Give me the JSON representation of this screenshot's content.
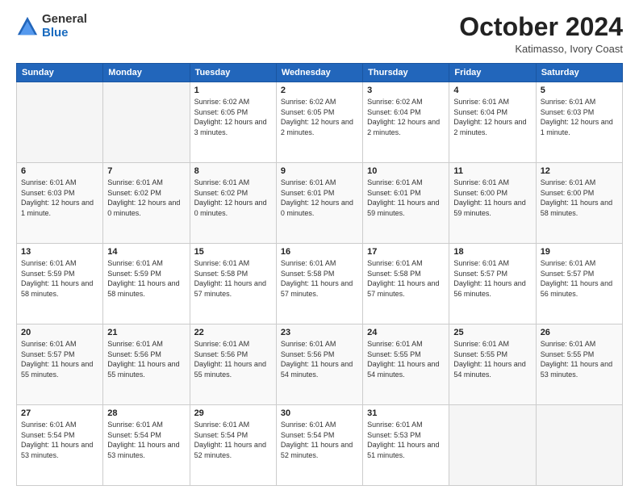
{
  "header": {
    "logo_general": "General",
    "logo_blue": "Blue",
    "month_title": "October 2024",
    "subtitle": "Katimasso, Ivory Coast"
  },
  "days_of_week": [
    "Sunday",
    "Monday",
    "Tuesday",
    "Wednesday",
    "Thursday",
    "Friday",
    "Saturday"
  ],
  "weeks": [
    [
      {
        "day": "",
        "info": ""
      },
      {
        "day": "",
        "info": ""
      },
      {
        "day": "1",
        "info": "Sunrise: 6:02 AM\nSunset: 6:05 PM\nDaylight: 12 hours\nand 3 minutes."
      },
      {
        "day": "2",
        "info": "Sunrise: 6:02 AM\nSunset: 6:05 PM\nDaylight: 12 hours\nand 2 minutes."
      },
      {
        "day": "3",
        "info": "Sunrise: 6:02 AM\nSunset: 6:04 PM\nDaylight: 12 hours\nand 2 minutes."
      },
      {
        "day": "4",
        "info": "Sunrise: 6:01 AM\nSunset: 6:04 PM\nDaylight: 12 hours\nand 2 minutes."
      },
      {
        "day": "5",
        "info": "Sunrise: 6:01 AM\nSunset: 6:03 PM\nDaylight: 12 hours\nand 1 minute."
      }
    ],
    [
      {
        "day": "6",
        "info": "Sunrise: 6:01 AM\nSunset: 6:03 PM\nDaylight: 12 hours\nand 1 minute."
      },
      {
        "day": "7",
        "info": "Sunrise: 6:01 AM\nSunset: 6:02 PM\nDaylight: 12 hours\nand 0 minutes."
      },
      {
        "day": "8",
        "info": "Sunrise: 6:01 AM\nSunset: 6:02 PM\nDaylight: 12 hours\nand 0 minutes."
      },
      {
        "day": "9",
        "info": "Sunrise: 6:01 AM\nSunset: 6:01 PM\nDaylight: 12 hours\nand 0 minutes."
      },
      {
        "day": "10",
        "info": "Sunrise: 6:01 AM\nSunset: 6:01 PM\nDaylight: 11 hours\nand 59 minutes."
      },
      {
        "day": "11",
        "info": "Sunrise: 6:01 AM\nSunset: 6:00 PM\nDaylight: 11 hours\nand 59 minutes."
      },
      {
        "day": "12",
        "info": "Sunrise: 6:01 AM\nSunset: 6:00 PM\nDaylight: 11 hours\nand 58 minutes."
      }
    ],
    [
      {
        "day": "13",
        "info": "Sunrise: 6:01 AM\nSunset: 5:59 PM\nDaylight: 11 hours\nand 58 minutes."
      },
      {
        "day": "14",
        "info": "Sunrise: 6:01 AM\nSunset: 5:59 PM\nDaylight: 11 hours\nand 58 minutes."
      },
      {
        "day": "15",
        "info": "Sunrise: 6:01 AM\nSunset: 5:58 PM\nDaylight: 11 hours\nand 57 minutes."
      },
      {
        "day": "16",
        "info": "Sunrise: 6:01 AM\nSunset: 5:58 PM\nDaylight: 11 hours\nand 57 minutes."
      },
      {
        "day": "17",
        "info": "Sunrise: 6:01 AM\nSunset: 5:58 PM\nDaylight: 11 hours\nand 57 minutes."
      },
      {
        "day": "18",
        "info": "Sunrise: 6:01 AM\nSunset: 5:57 PM\nDaylight: 11 hours\nand 56 minutes."
      },
      {
        "day": "19",
        "info": "Sunrise: 6:01 AM\nSunset: 5:57 PM\nDaylight: 11 hours\nand 56 minutes."
      }
    ],
    [
      {
        "day": "20",
        "info": "Sunrise: 6:01 AM\nSunset: 5:57 PM\nDaylight: 11 hours\nand 55 minutes."
      },
      {
        "day": "21",
        "info": "Sunrise: 6:01 AM\nSunset: 5:56 PM\nDaylight: 11 hours\nand 55 minutes."
      },
      {
        "day": "22",
        "info": "Sunrise: 6:01 AM\nSunset: 5:56 PM\nDaylight: 11 hours\nand 55 minutes."
      },
      {
        "day": "23",
        "info": "Sunrise: 6:01 AM\nSunset: 5:56 PM\nDaylight: 11 hours\nand 54 minutes."
      },
      {
        "day": "24",
        "info": "Sunrise: 6:01 AM\nSunset: 5:55 PM\nDaylight: 11 hours\nand 54 minutes."
      },
      {
        "day": "25",
        "info": "Sunrise: 6:01 AM\nSunset: 5:55 PM\nDaylight: 11 hours\nand 54 minutes."
      },
      {
        "day": "26",
        "info": "Sunrise: 6:01 AM\nSunset: 5:55 PM\nDaylight: 11 hours\nand 53 minutes."
      }
    ],
    [
      {
        "day": "27",
        "info": "Sunrise: 6:01 AM\nSunset: 5:54 PM\nDaylight: 11 hours\nand 53 minutes."
      },
      {
        "day": "28",
        "info": "Sunrise: 6:01 AM\nSunset: 5:54 PM\nDaylight: 11 hours\nand 53 minutes."
      },
      {
        "day": "29",
        "info": "Sunrise: 6:01 AM\nSunset: 5:54 PM\nDaylight: 11 hours\nand 52 minutes."
      },
      {
        "day": "30",
        "info": "Sunrise: 6:01 AM\nSunset: 5:54 PM\nDaylight: 11 hours\nand 52 minutes."
      },
      {
        "day": "31",
        "info": "Sunrise: 6:01 AM\nSunset: 5:53 PM\nDaylight: 11 hours\nand 51 minutes."
      },
      {
        "day": "",
        "info": ""
      },
      {
        "day": "",
        "info": ""
      }
    ]
  ]
}
